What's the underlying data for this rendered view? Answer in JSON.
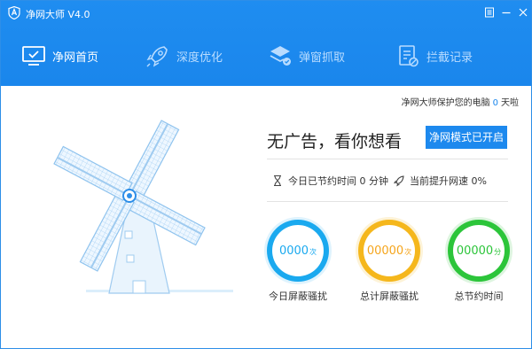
{
  "window": {
    "title": "净网大师 V4.0"
  },
  "titlebar_buttons": {
    "menu_icon": "menu-icon",
    "min_icon": "minimize-icon",
    "close_icon": "close-icon"
  },
  "nav": {
    "tabs": [
      {
        "label": "净网首页",
        "icon": "monitor-icon",
        "active": true
      },
      {
        "label": "深度优化",
        "icon": "rocket-icon",
        "active": false
      },
      {
        "label": "弹窗抓取",
        "icon": "layers-icon",
        "active": false
      },
      {
        "label": "拦截记录",
        "icon": "log-icon",
        "active": false
      }
    ]
  },
  "status": {
    "prefix": "净网大师保护您的电脑",
    "days": "0",
    "suffix": "天啦"
  },
  "main": {
    "slogan": "无广告，看你想看",
    "mode_button": "净网模式已开启",
    "saved_time_text": "今日已节约时间 0 分钟",
    "speed_text": "当前提升网速 0%"
  },
  "stats": [
    {
      "value": "0000",
      "unit": "次",
      "label": "今日屏蔽骚扰",
      "color": "#1aa9ef"
    },
    {
      "value": "00000",
      "unit": "次",
      "label": "总计屏蔽骚扰",
      "color": "#f5b71c"
    },
    {
      "value": "00000",
      "unit": "分",
      "label": "总节约时间",
      "color": "#2cc53a"
    }
  ],
  "colors": {
    "accent": "#1a86ec",
    "header": "#1f8df0"
  }
}
